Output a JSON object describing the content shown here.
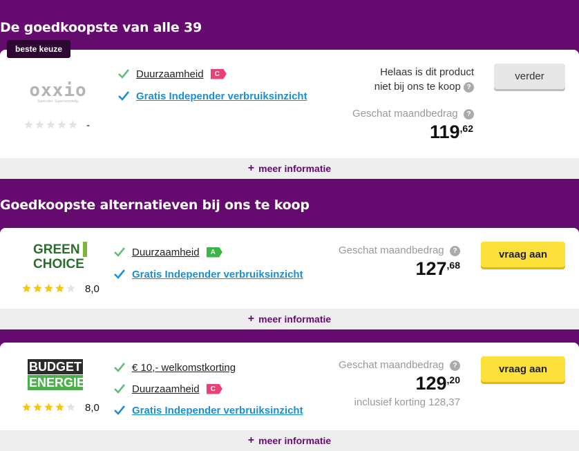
{
  "sections": {
    "cheapest_title": "De goedkoopste van alle 39",
    "alternatives_title": "Goedkoopste alternatieven bij ons te koop"
  },
  "card1": {
    "badge": "beste keuze",
    "logo_name": "oxxio",
    "logo_tagline": "Superslim. Supervoordelig.",
    "rating_text": "-",
    "stars_filled": 0,
    "feature1": "Duurzaamheid",
    "feature1_label": "C",
    "feature2": "Gratis Independer verbruiksinzicht",
    "unavailable_line1": "Helaas is dit product",
    "unavailable_line2": "niet bij ons te koop",
    "estimate_label": "Geschat maandbedrag",
    "price_whole": "119",
    "price_dec": ",62",
    "button": "verder",
    "more_info": "meer informatie"
  },
  "card2": {
    "logo_line1": "GREEN",
    "logo_line2": "CHOICE",
    "rating": "8,0",
    "stars_filled": 4,
    "feature1": "Duurzaamheid",
    "feature1_label": "A",
    "feature2": "Gratis Independer verbruiksinzicht",
    "estimate_label": "Geschat maandbedrag",
    "price_whole": "127",
    "price_dec": ",68",
    "button": "vraag aan",
    "more_info": "meer informatie"
  },
  "card3": {
    "logo_line1": "BUDGET",
    "logo_line2": "ENERGIE",
    "rating": "8,0",
    "stars_filled": 4,
    "feature0": "€ 10,- welkomstkorting",
    "feature1": "Duurzaamheid",
    "feature1_label": "C",
    "feature2": "Gratis Independer verbruiksinzicht",
    "estimate_label": "Geschat maandbedrag",
    "price_whole": "129",
    "price_dec": ",20",
    "discount_note": "inclusief korting 128,37",
    "button": "vraag aan",
    "more_info": "meer informatie"
  },
  "icons": {
    "plus": "+",
    "question": "?"
  },
  "colors": {
    "brand_purple": "#650a6f",
    "check_green": "#5fbf7a",
    "check_blue": "#1a8fd6",
    "cta_yellow": "#fde03a",
    "label_c": "#ec3f74",
    "label_a": "#39b54a"
  }
}
